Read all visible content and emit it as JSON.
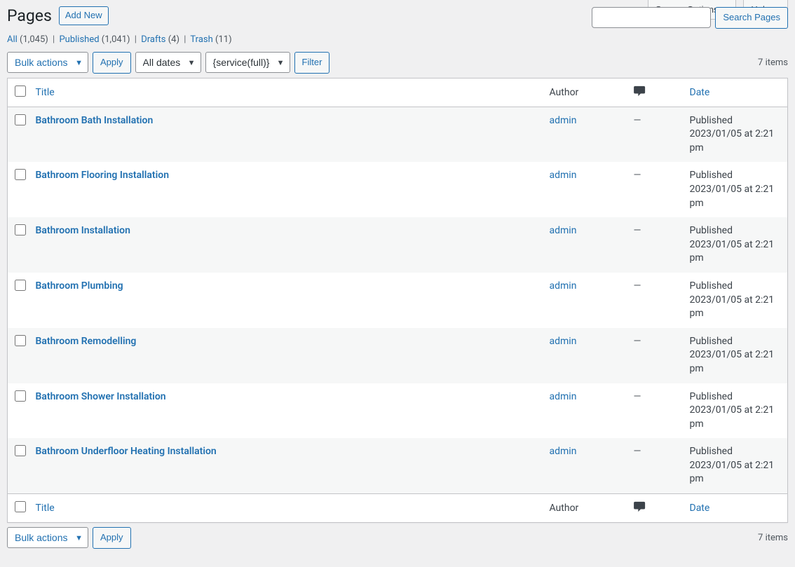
{
  "top_panels": {
    "screen_options": "Screen Options",
    "help": "Help"
  },
  "heading": {
    "title": "Pages",
    "add_new": "Add New"
  },
  "search": {
    "button": "Search Pages",
    "value": ""
  },
  "filters": {
    "all": {
      "label": "All",
      "count": "(1,045)"
    },
    "published": {
      "label": "Published",
      "count": "(1,041)"
    },
    "drafts": {
      "label": "Drafts",
      "count": "(4)"
    },
    "trash": {
      "label": "Trash",
      "count": "(11)"
    }
  },
  "tablenav": {
    "bulk_actions": "Bulk actions",
    "apply": "Apply",
    "all_dates": "All dates",
    "service_full": "{service(full)}",
    "filter": "Filter",
    "items_count": "7 items"
  },
  "columns": {
    "title": "Title",
    "author": "Author",
    "date": "Date"
  },
  "rows": [
    {
      "title": "Bathroom Bath Installation",
      "author": "admin",
      "comments": "—",
      "status": "Published",
      "date": "2023/01/05 at 2:21 pm"
    },
    {
      "title": "Bathroom Flooring Installation",
      "author": "admin",
      "comments": "—",
      "status": "Published",
      "date": "2023/01/05 at 2:21 pm"
    },
    {
      "title": "Bathroom Installation",
      "author": "admin",
      "comments": "—",
      "status": "Published",
      "date": "2023/01/05 at 2:21 pm"
    },
    {
      "title": "Bathroom Plumbing",
      "author": "admin",
      "comments": "—",
      "status": "Published",
      "date": "2023/01/05 at 2:21 pm"
    },
    {
      "title": "Bathroom Remodelling",
      "author": "admin",
      "comments": "—",
      "status": "Published",
      "date": "2023/01/05 at 2:21 pm"
    },
    {
      "title": "Bathroom Shower Installation",
      "author": "admin",
      "comments": "—",
      "status": "Published",
      "date": "2023/01/05 at 2:21 pm"
    },
    {
      "title": "Bathroom Underfloor Heating Installation",
      "author": "admin",
      "comments": "—",
      "status": "Published",
      "date": "2023/01/05 at 2:21 pm"
    }
  ]
}
